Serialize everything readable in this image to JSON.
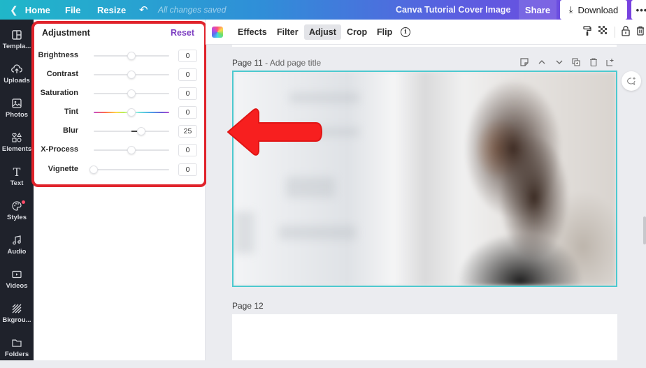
{
  "topbar": {
    "home": "Home",
    "file": "File",
    "resize": "Resize",
    "undo_icon": "undo-icon",
    "save_status": "All changes saved",
    "doc_title": "Canva Tutorial Cover Image",
    "share": "Share",
    "download": "Download",
    "more": "•••"
  },
  "sidebar": {
    "items": [
      {
        "label": "Templa...",
        "icon": "templates-icon"
      },
      {
        "label": "Uploads",
        "icon": "uploads-icon"
      },
      {
        "label": "Photos",
        "icon": "photos-icon"
      },
      {
        "label": "Elements",
        "icon": "elements-icon"
      },
      {
        "label": "Text",
        "icon": "text-icon"
      },
      {
        "label": "Styles",
        "icon": "styles-icon",
        "notification": true
      },
      {
        "label": "Audio",
        "icon": "audio-icon"
      },
      {
        "label": "Videos",
        "icon": "videos-icon"
      },
      {
        "label": "Bkgrou...",
        "icon": "background-icon"
      },
      {
        "label": "Folders",
        "icon": "folders-icon"
      }
    ]
  },
  "adjust_panel": {
    "title": "Adjustment",
    "reset": "Reset",
    "sliders": [
      {
        "label": "Brightness",
        "value": "0",
        "position": 0.5
      },
      {
        "label": "Contrast",
        "value": "0",
        "position": 0.5
      },
      {
        "label": "Saturation",
        "value": "0",
        "position": 0.5
      },
      {
        "label": "Tint",
        "value": "0",
        "position": 0.5
      },
      {
        "label": "Blur",
        "value": "25",
        "position": 0.625
      },
      {
        "label": "X-Process",
        "value": "0",
        "position": 0.5
      },
      {
        "label": "Vignette",
        "value": "0",
        "position": 0.0
      }
    ]
  },
  "editor_toolbar": {
    "effects": "Effects",
    "filter": "Filter",
    "adjust": "Adjust",
    "crop": "Crop",
    "flip": "Flip",
    "info": "i",
    "active_tab": "Adjust"
  },
  "pages": [
    {
      "label": "Page 11",
      "separator": " - ",
      "title_placeholder": "Add page title"
    },
    {
      "label": "Page 12"
    }
  ],
  "colors": {
    "accent_purple": "#7d3fc2",
    "selection_teal": "#4cc9cf",
    "annotation_red": "#e0232b",
    "sidebar_dark": "#1f222b"
  }
}
